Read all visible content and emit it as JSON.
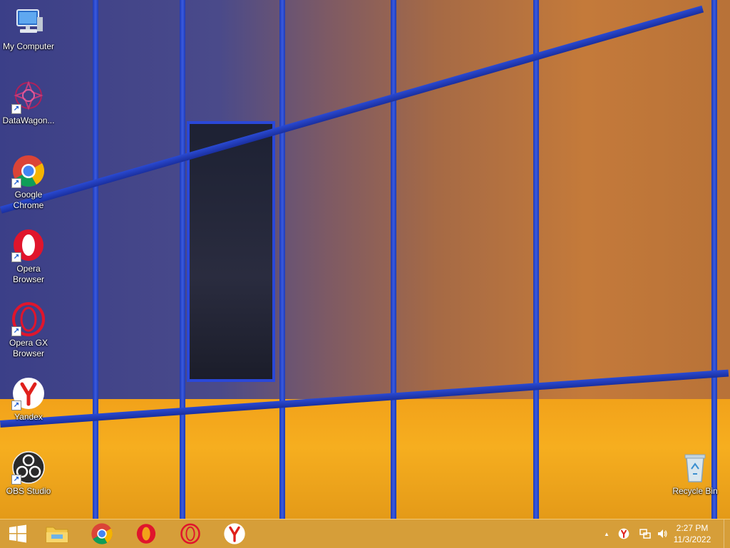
{
  "desktop": {
    "icons": [
      {
        "label": "My Computer",
        "icon": "computer-icon",
        "shortcut": false
      },
      {
        "label": "DataWagon...",
        "icon": "datawagon-icon",
        "shortcut": true
      },
      {
        "label": "Google Chrome",
        "icon": "chrome-icon",
        "shortcut": true
      },
      {
        "label": "Opera Browser",
        "icon": "opera-icon",
        "shortcut": true
      },
      {
        "label": "Opera GX Browser",
        "icon": "opera-gx-icon",
        "shortcut": true
      },
      {
        "label": "Yandex",
        "icon": "yandex-icon",
        "shortcut": true
      },
      {
        "label": "OBS Studio",
        "icon": "obs-icon",
        "shortcut": true
      }
    ],
    "recycle_bin": {
      "label": "Recycle Bin",
      "icon": "recycle-bin-icon"
    }
  },
  "taskbar": {
    "start": {
      "icon": "windows-start-icon"
    },
    "pinned": [
      {
        "name": "File Explorer",
        "icon": "file-explorer-icon"
      },
      {
        "name": "Google Chrome",
        "icon": "chrome-icon"
      },
      {
        "name": "Opera",
        "icon": "opera-icon"
      },
      {
        "name": "Opera GX",
        "icon": "opera-gx-icon"
      },
      {
        "name": "Yandex",
        "icon": "yandex-icon"
      }
    ],
    "tray": {
      "chevron": "▲",
      "icons": [
        "yandex-tray-icon",
        "network-icon",
        "volume-icon"
      ]
    },
    "clock": {
      "time": "2:27 PM",
      "date": "11/3/2022"
    }
  },
  "colors": {
    "taskbar": "#d29628",
    "mullion": "#2a48d8",
    "glass_orange": "#f2a21a",
    "glass_upper": "#b06a3c"
  }
}
